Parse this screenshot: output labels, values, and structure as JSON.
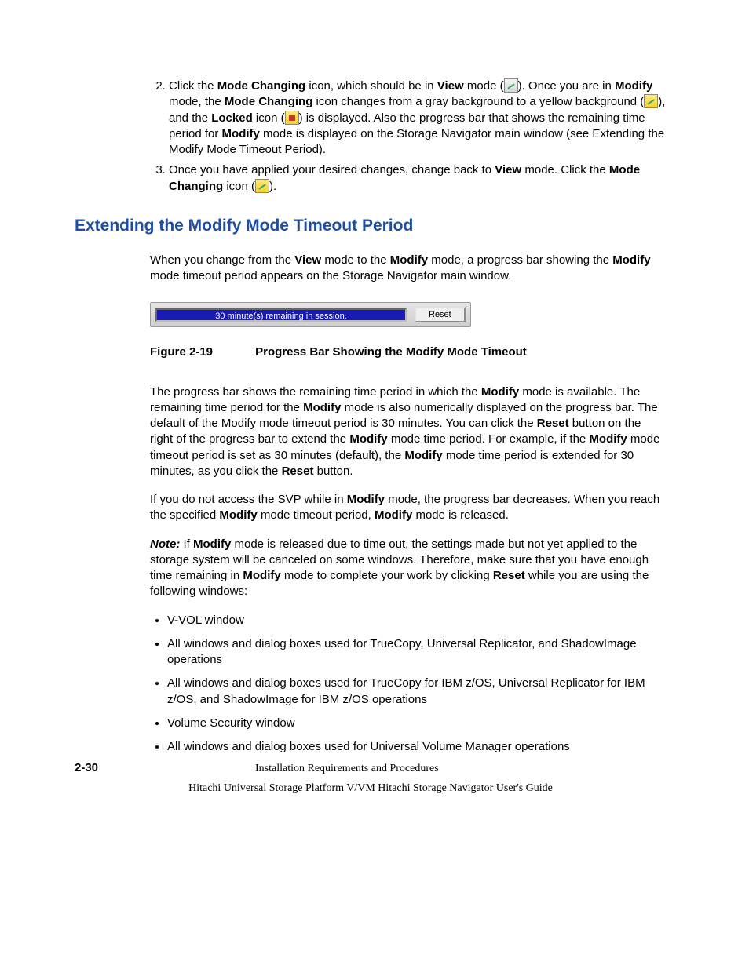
{
  "steps": {
    "step2": {
      "t1": "Click the ",
      "b1": "Mode Changing",
      "t2": " icon, which should be in ",
      "b2": "View",
      "t3": " mode (",
      "t4": "). Once you are in ",
      "b3": "Modify",
      "t5": " mode, the ",
      "b4": "Mode Changing",
      "t6": " icon changes from a gray background to a yellow background (",
      "t7": "), and the ",
      "b5": "Locked",
      "t8": " icon (",
      "t9": ") is displayed. Also the progress bar that shows the remaining time period for ",
      "b6": "Modify",
      "t10": " mode is displayed on the Storage Navigator main window (see Extending the Modify Mode Timeout Period)."
    },
    "step3": {
      "t1": "Once you have applied your desired changes, change back to ",
      "b1": "View",
      "t2": " mode. Click the ",
      "b2": "Mode Changing",
      "t3": " icon (",
      "t4": ")."
    }
  },
  "section_title": "Extending the Modify Mode Timeout Period",
  "intro": {
    "t1": "When you change from the ",
    "b1": "View",
    "t2": " mode to the ",
    "b2": "Modify",
    "t3": " mode, a progress bar showing the ",
    "b3": "Modify",
    "t4": " mode timeout period appears on the Storage Navigator main window."
  },
  "progress_bar": {
    "label": "30 minute(s) remaining in session.",
    "reset_label": "Reset"
  },
  "figure_caption": {
    "num": "Figure 2-19",
    "title": "Progress Bar Showing the Modify Mode Timeout"
  },
  "para2": {
    "t1": "The progress bar shows the remaining time period in which the ",
    "b1": "Modify",
    "t2": " mode is available. The remaining time period for the ",
    "b2": "Modify",
    "t3": " mode is also numerically displayed on the progress bar. The default of the Modify mode timeout period is 30 minutes. You can click the ",
    "b3": "Reset",
    "t4": " button on the right of the progress bar to extend the ",
    "b4": "Modify",
    "t5": " mode time period. For example, if the ",
    "b5": "Modify",
    "t6": " mode timeout period is set as 30 minutes (default), the ",
    "b6": "Modify",
    "t7": " mode time period is extended for 30 minutes, as you click the ",
    "b7": "Reset",
    "t8": " button."
  },
  "para3": {
    "t1": "If you do not access the SVP while in ",
    "b1": "Modify",
    "t2": " mode, the progress bar decreases. When you reach the specified ",
    "b2": "Modify",
    "t3": " mode timeout period, ",
    "b3": "Modify",
    "t4": " mode is released."
  },
  "note": {
    "label": "Note:",
    "t1": " If ",
    "b1": "Modify",
    "t2": " mode is released due to time out, the settings made but not yet applied to the storage system will be canceled on some windows. Therefore, make sure that you have enough time remaining in ",
    "b2": "Modify",
    "t3": " mode to complete your work by clicking ",
    "b3": "Reset",
    "t4": " while you are using the following windows:"
  },
  "bullets": [
    "V-VOL window",
    "All windows and dialog boxes used for TrueCopy, Universal Replicator, and ShadowImage operations",
    "All windows and dialog boxes used for TrueCopy for IBM z/OS, Universal Replicator for IBM z/OS, and ShadowImage for IBM z/OS operations",
    "Volume Security window",
    "All windows and dialog boxes used for Universal Volume Manager operations"
  ],
  "footer": {
    "page_num": "2-30",
    "section_name": "Installation Requirements and Procedures",
    "guide_name": "Hitachi Universal Storage Platform V/VM Hitachi Storage Navigator User's Guide"
  }
}
